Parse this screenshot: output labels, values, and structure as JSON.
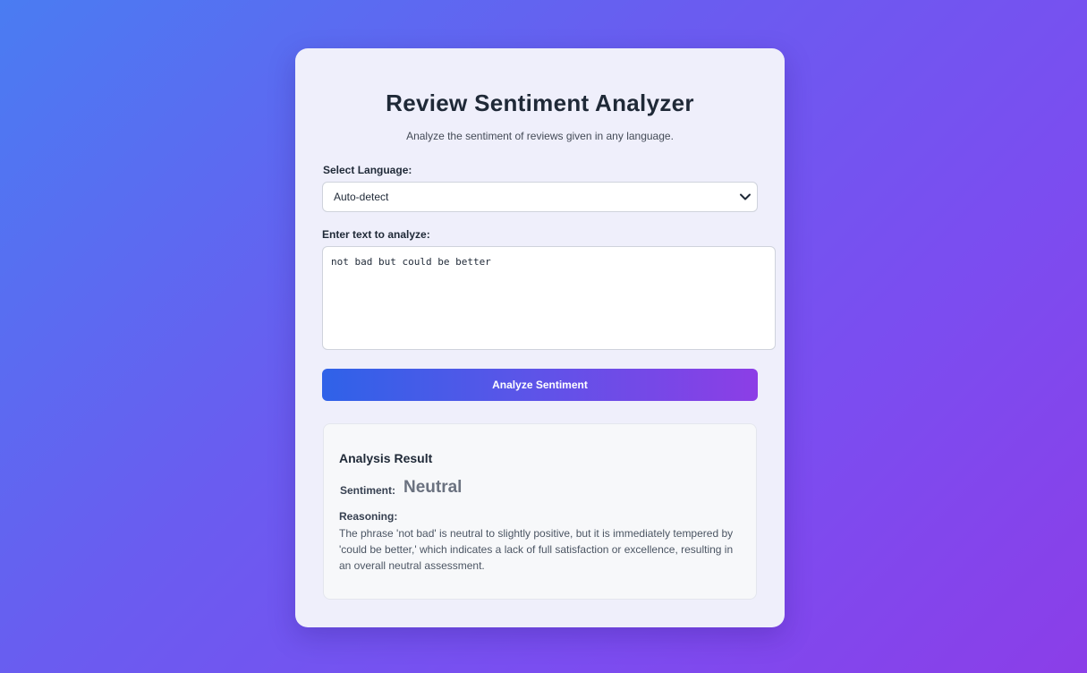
{
  "header": {
    "title": "Review Sentiment Analyzer",
    "subtitle": "Analyze the sentiment of reviews given in any language."
  },
  "language": {
    "label": "Select Language:",
    "selected": "Auto-detect"
  },
  "input": {
    "label": "Enter text to analyze:",
    "value": "not bad but could be better"
  },
  "actions": {
    "analyze_label": "Analyze Sentiment"
  },
  "result": {
    "title": "Analysis Result",
    "sentiment_label": "Sentiment:",
    "sentiment_value": "Neutral",
    "reasoning_label": "Reasoning:",
    "reasoning_text": "The phrase 'not bad' is neutral to slightly positive, but it is immediately tempered by 'could be better,' which indicates a lack of full satisfaction or excellence, resulting in an overall neutral assessment."
  },
  "icons": {
    "select_chevron": "chevron-down-icon"
  },
  "colors": {
    "accent_start": "#2f62e8",
    "accent_end": "#8c3ee6",
    "neutral_sentiment": "#6b7280"
  }
}
